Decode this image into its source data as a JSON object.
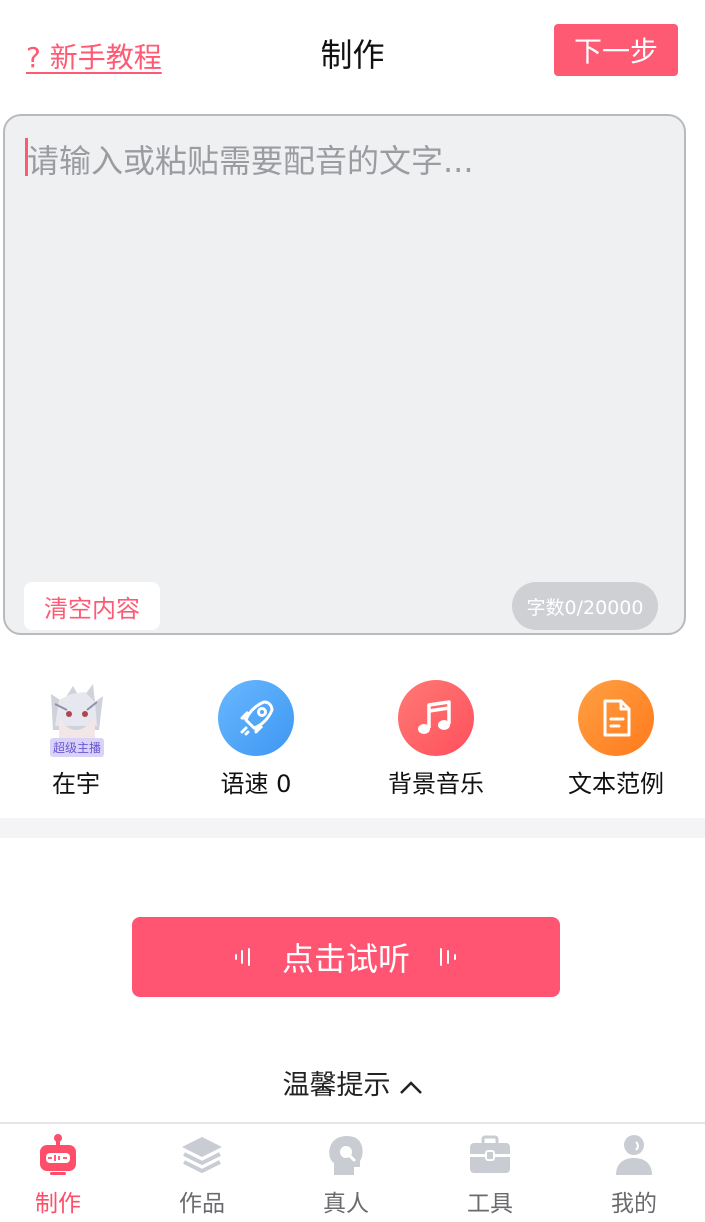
{
  "header": {
    "tutorial_label": "? 新手教程",
    "title": "制作",
    "next_label": "下一步"
  },
  "editor": {
    "placeholder": "请输入或粘贴需要配音的文字...",
    "clear_label": "清空内容",
    "counter": "字数0/20000"
  },
  "tools": {
    "voice_name": "在宇",
    "voice_badge": "超级主播",
    "speed_label": "语速 0",
    "music_label": "背景音乐",
    "sample_label": "文本范例"
  },
  "listen_label": "点击试听",
  "tips_label": "温馨提示",
  "tabs": [
    {
      "label": "制作",
      "icon": "robot-icon",
      "active": true
    },
    {
      "label": "作品",
      "icon": "layers-icon",
      "active": false
    },
    {
      "label": "真人",
      "icon": "human-voice-icon",
      "active": false
    },
    {
      "label": "工具",
      "icon": "toolbox-icon",
      "active": false
    },
    {
      "label": "我的",
      "icon": "profile-icon",
      "active": false
    }
  ],
  "colors": {
    "accent": "#ff5a74",
    "speed_circle": "#4aa5f5",
    "music_circle": "#ff6166",
    "sample_circle": "#ff8a2e",
    "inactive_tab_icon": "#c9ccd3"
  }
}
